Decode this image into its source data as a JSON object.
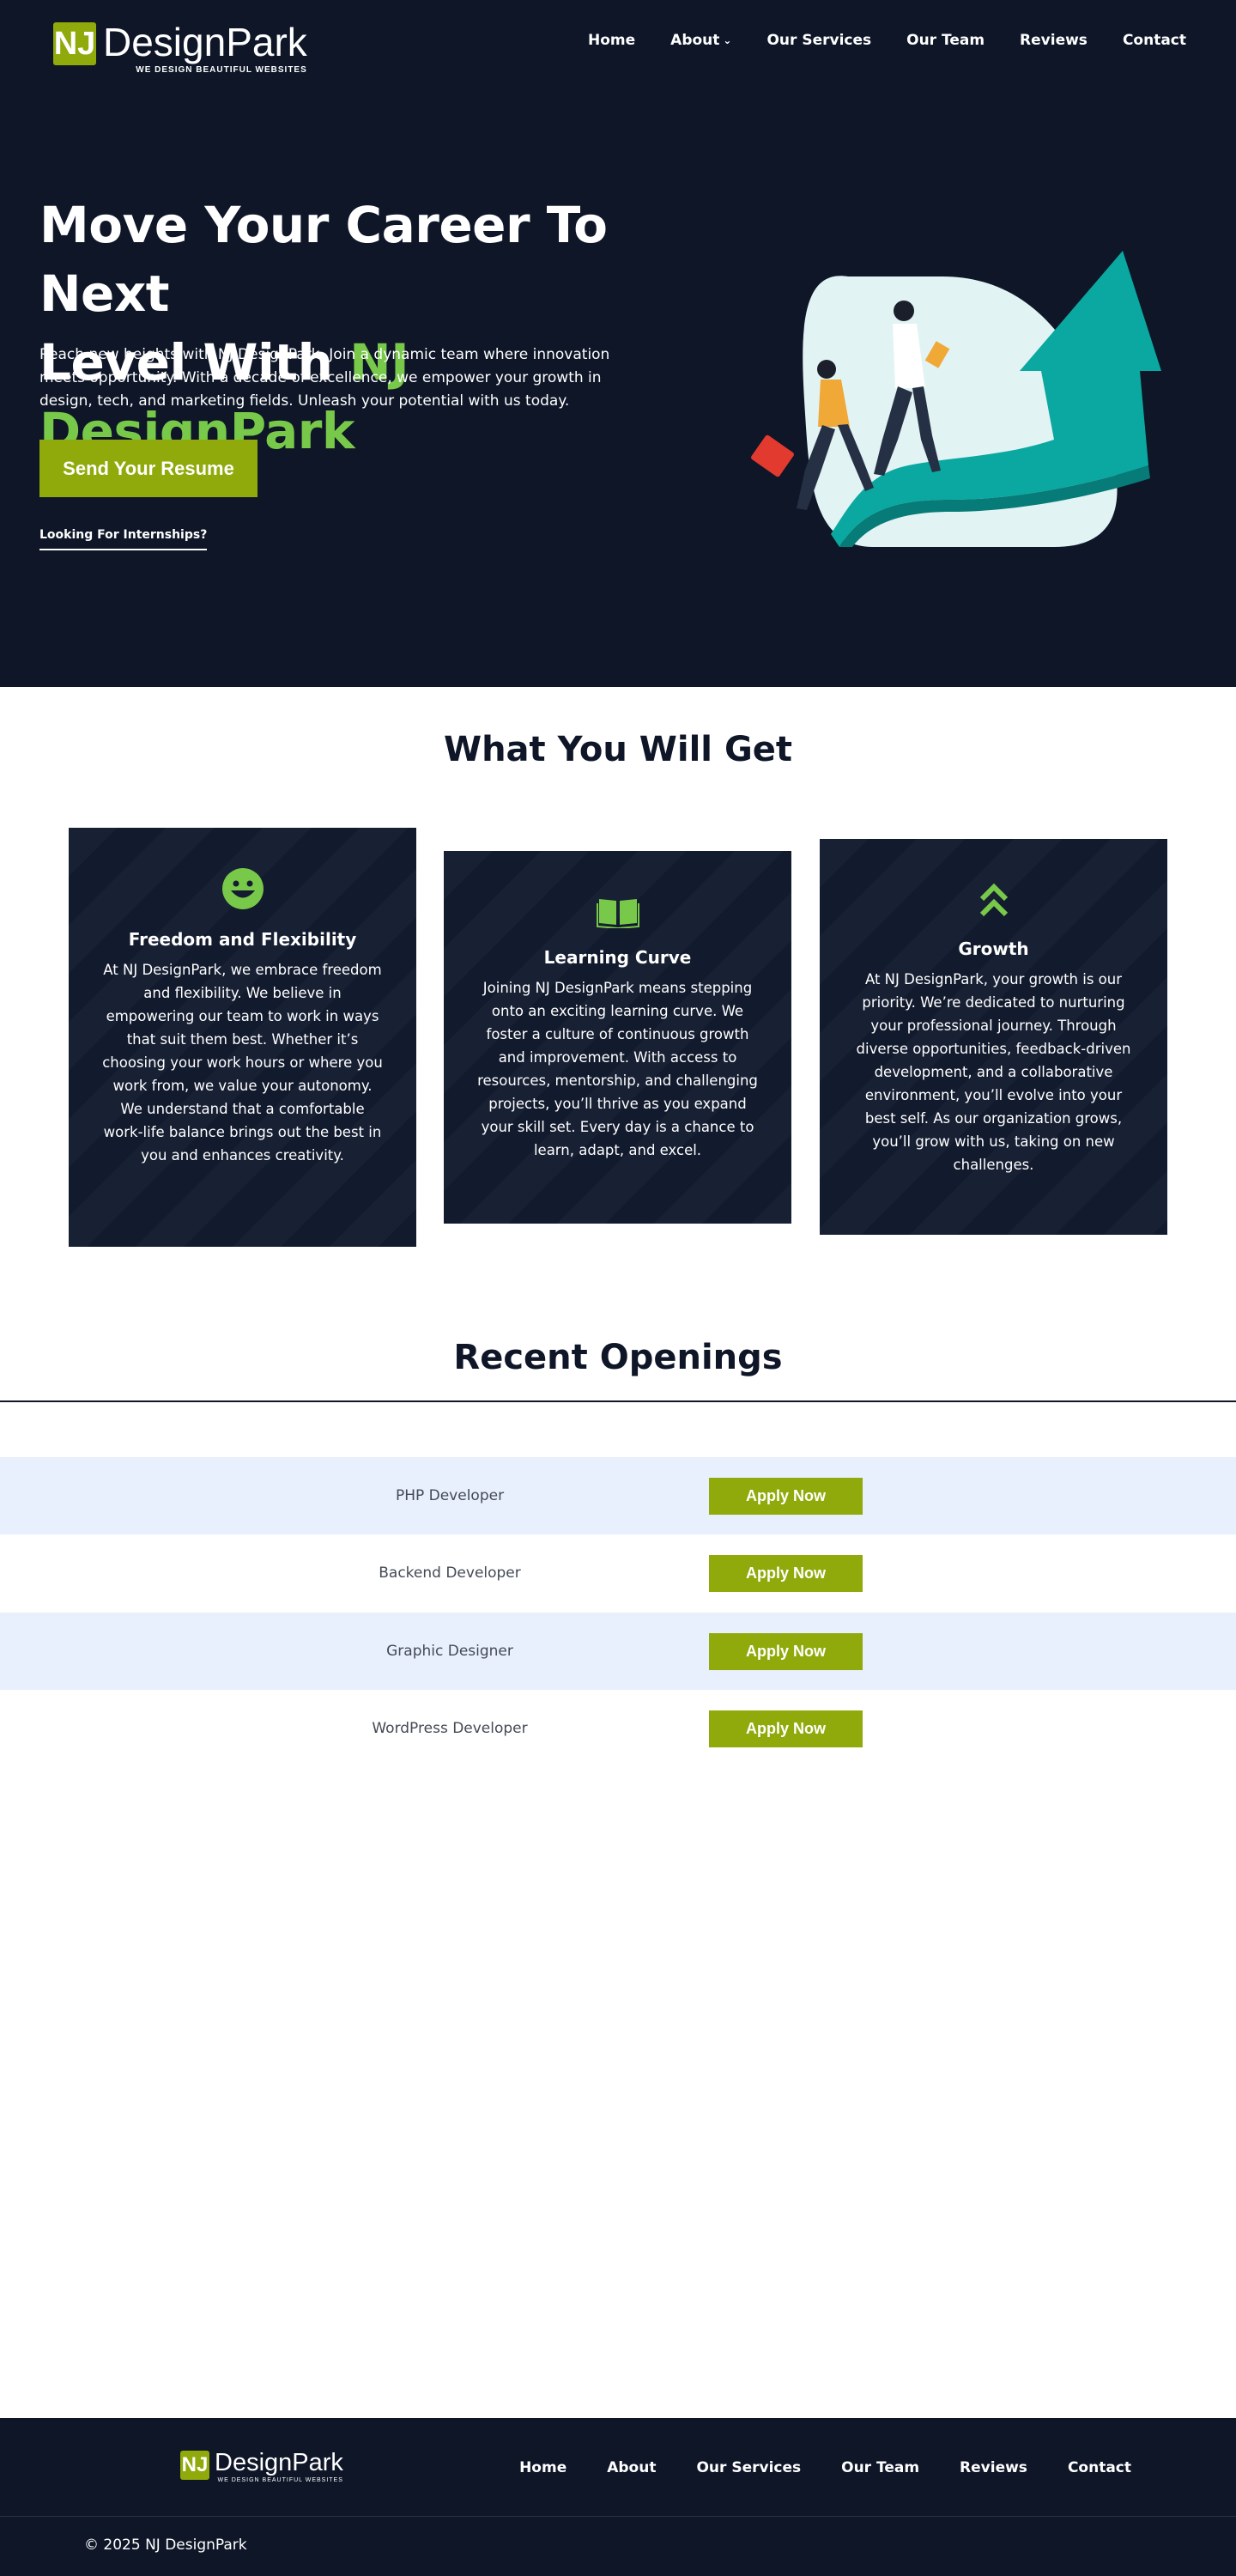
{
  "brand": {
    "badge": "NJ",
    "name": "DesignPark",
    "tagline": "WE DESIGN BEAUTIFUL WEBSITES",
    "accent_color": "#8faa0a",
    "green_color": "#78c84a",
    "navy_color": "#0e1628"
  },
  "nav": {
    "home": "Home",
    "about": "About",
    "about_caret": "⌄",
    "services": "Our Services",
    "team": "Our Team",
    "reviews": "Reviews",
    "contact": "Contact"
  },
  "hero": {
    "title_line1": "Move Your Career To Next",
    "title_line2_prefix": "Level With ",
    "title_accent": "NJ DesignPark",
    "description": "Reach new heights with NJ DesignPark. Join a dynamic team where innovation meets opportunity. With a decade of excellence, we empower your growth in design, tech, and marketing fields. Unleash your potential with us today.",
    "cta_label": "Send Your Resume",
    "internship_link": "Looking For Internships?"
  },
  "benefits": {
    "title": "What You Will Get",
    "cards": [
      {
        "icon": "smile-icon",
        "title": "Freedom and Flexibility",
        "text": "At NJ DesignPark, we embrace freedom and flexibility. We believe in empowering our team to work in ways that suit them best. Whether it’s choosing your work hours or where you work from, we value your autonomy. We understand that a comfortable work-life balance brings out the best in you and enhances creativity."
      },
      {
        "icon": "book-icon",
        "title": "Learning Curve",
        "text": "Joining NJ DesignPark means stepping onto an exciting learning curve. We foster a culture of continuous growth and improvement. With access to resources, mentorship, and challenging projects, you’ll thrive as you expand your skill set. Every day is a chance to learn, adapt, and excel."
      },
      {
        "icon": "chevrons-up-icon",
        "title": "Growth",
        "text": "At NJ DesignPark, your growth is our priority. We’re dedicated to nurturing your professional journey. Through diverse opportunities, feedback-driven development, and a collaborative environment, you’ll evolve into your best self. As our organization grows, you’ll grow with us, taking on new challenges."
      }
    ]
  },
  "openings": {
    "title": "Recent Openings",
    "apply_label": "Apply Now",
    "jobs": [
      "PHP Developer",
      "Backend Developer",
      "Graphic Designer",
      "WordPress Developer"
    ]
  },
  "footer": {
    "nav": [
      "Home",
      "About",
      "Our Services",
      "Our Team",
      "Reviews",
      "Contact"
    ],
    "copyright": "© 2025 NJ DesignPark"
  }
}
